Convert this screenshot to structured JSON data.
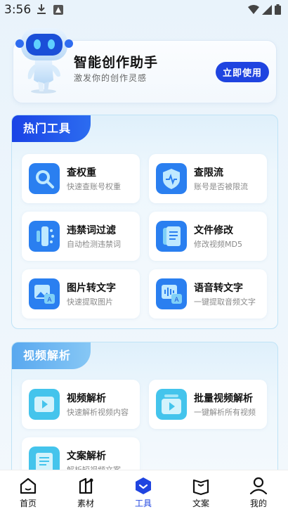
{
  "status_bar": {
    "time": "3:56"
  },
  "hero": {
    "title": "智能创作助手",
    "subtitle": "激发你的创作灵感",
    "button_label": "立即使用"
  },
  "hot_tools": {
    "heading": "热门工具",
    "items": [
      {
        "title": "查权重",
        "subtitle": "快速查账号权重",
        "icon": "search-icon"
      },
      {
        "title": "查限流",
        "subtitle": "账号是否被限流",
        "icon": "shield-pulse-icon"
      },
      {
        "title": "违禁词过滤",
        "subtitle": "自动检测违禁词",
        "icon": "filter-icon"
      },
      {
        "title": "文件修改",
        "subtitle": "修改视频MD5",
        "icon": "document-icon"
      },
      {
        "title": "图片转文字",
        "subtitle": "快速提取图片",
        "icon": "image-text-icon"
      },
      {
        "title": "语音转文字",
        "subtitle": "一键提取音频文字",
        "icon": "voice-text-icon"
      }
    ]
  },
  "video_parse": {
    "heading": "视频解析",
    "items": [
      {
        "title": "视频解析",
        "subtitle": "快速解析视频内容",
        "icon": "video-play-icon"
      },
      {
        "title": "批量视频解析",
        "subtitle": "一键解析所有视频",
        "icon": "video-batch-icon"
      },
      {
        "title": "文案解析",
        "subtitle": "解析短视频文案",
        "icon": "copywriting-icon"
      }
    ]
  },
  "nav": {
    "items": [
      {
        "label": "首页",
        "icon": "home-icon"
      },
      {
        "label": "素材",
        "icon": "material-icon"
      },
      {
        "label": "工具",
        "icon": "tools-icon",
        "active": true
      },
      {
        "label": "文案",
        "icon": "book-icon"
      },
      {
        "label": "我的",
        "icon": "person-icon"
      }
    ]
  },
  "colors": {
    "accent": "#1f44e0",
    "panel_border": "#bfe3f6",
    "icon_blue": "#2a7ff0",
    "icon_cyan": "#44c4ec"
  }
}
